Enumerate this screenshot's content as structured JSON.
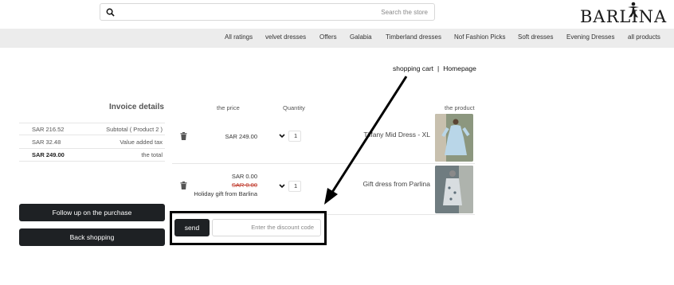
{
  "header": {
    "search": {
      "placeholder": "Search the store",
      "icon": "search-icon"
    },
    "logo": {
      "text": "BARLINA"
    }
  },
  "nav": {
    "items": [
      {
        "label": "All ratings"
      },
      {
        "label": "velvet dresses"
      },
      {
        "label": "Offers"
      },
      {
        "label": "Galabia"
      },
      {
        "label": "Timberland dresses"
      },
      {
        "label": "Nof Fashion Picks"
      },
      {
        "label": "Soft dresses"
      },
      {
        "label": "Evening Dresses"
      },
      {
        "label": "all products"
      }
    ]
  },
  "breadcrumb": {
    "current": "shopping cart",
    "separator": "|",
    "home": "Homepage"
  },
  "invoice": {
    "title": "Invoice details",
    "rows": [
      {
        "amount": "SAR 216.52",
        "label": "Subtotal ( Product 2 )"
      },
      {
        "amount": "SAR 32.48",
        "label": "Value added tax"
      },
      {
        "amount": "SAR 249.00",
        "label": "the total"
      }
    ]
  },
  "cart": {
    "columns": {
      "price": "the price",
      "quantity": "Quantity",
      "product": "the product"
    },
    "items": [
      {
        "price": "SAR 249.00",
        "quantity": "1",
        "name": "Tiffany Mid Dress - XL"
      },
      {
        "price": "SAR 0.00",
        "old_price": "SAR 0.00",
        "note": "Holiday gift from Barlina",
        "quantity": "1",
        "name": "Gift dress from Parlina"
      }
    ]
  },
  "actions": {
    "follow_up": "Follow up on the purchase",
    "back_shopping": "Back shopping"
  },
  "discount": {
    "send": "send",
    "placeholder": "Enter the discount code"
  },
  "colors": {
    "button_bg": "#1e2124",
    "nav_bg": "#ececec",
    "old_price": "#c0392b",
    "annotation": "#000000"
  }
}
